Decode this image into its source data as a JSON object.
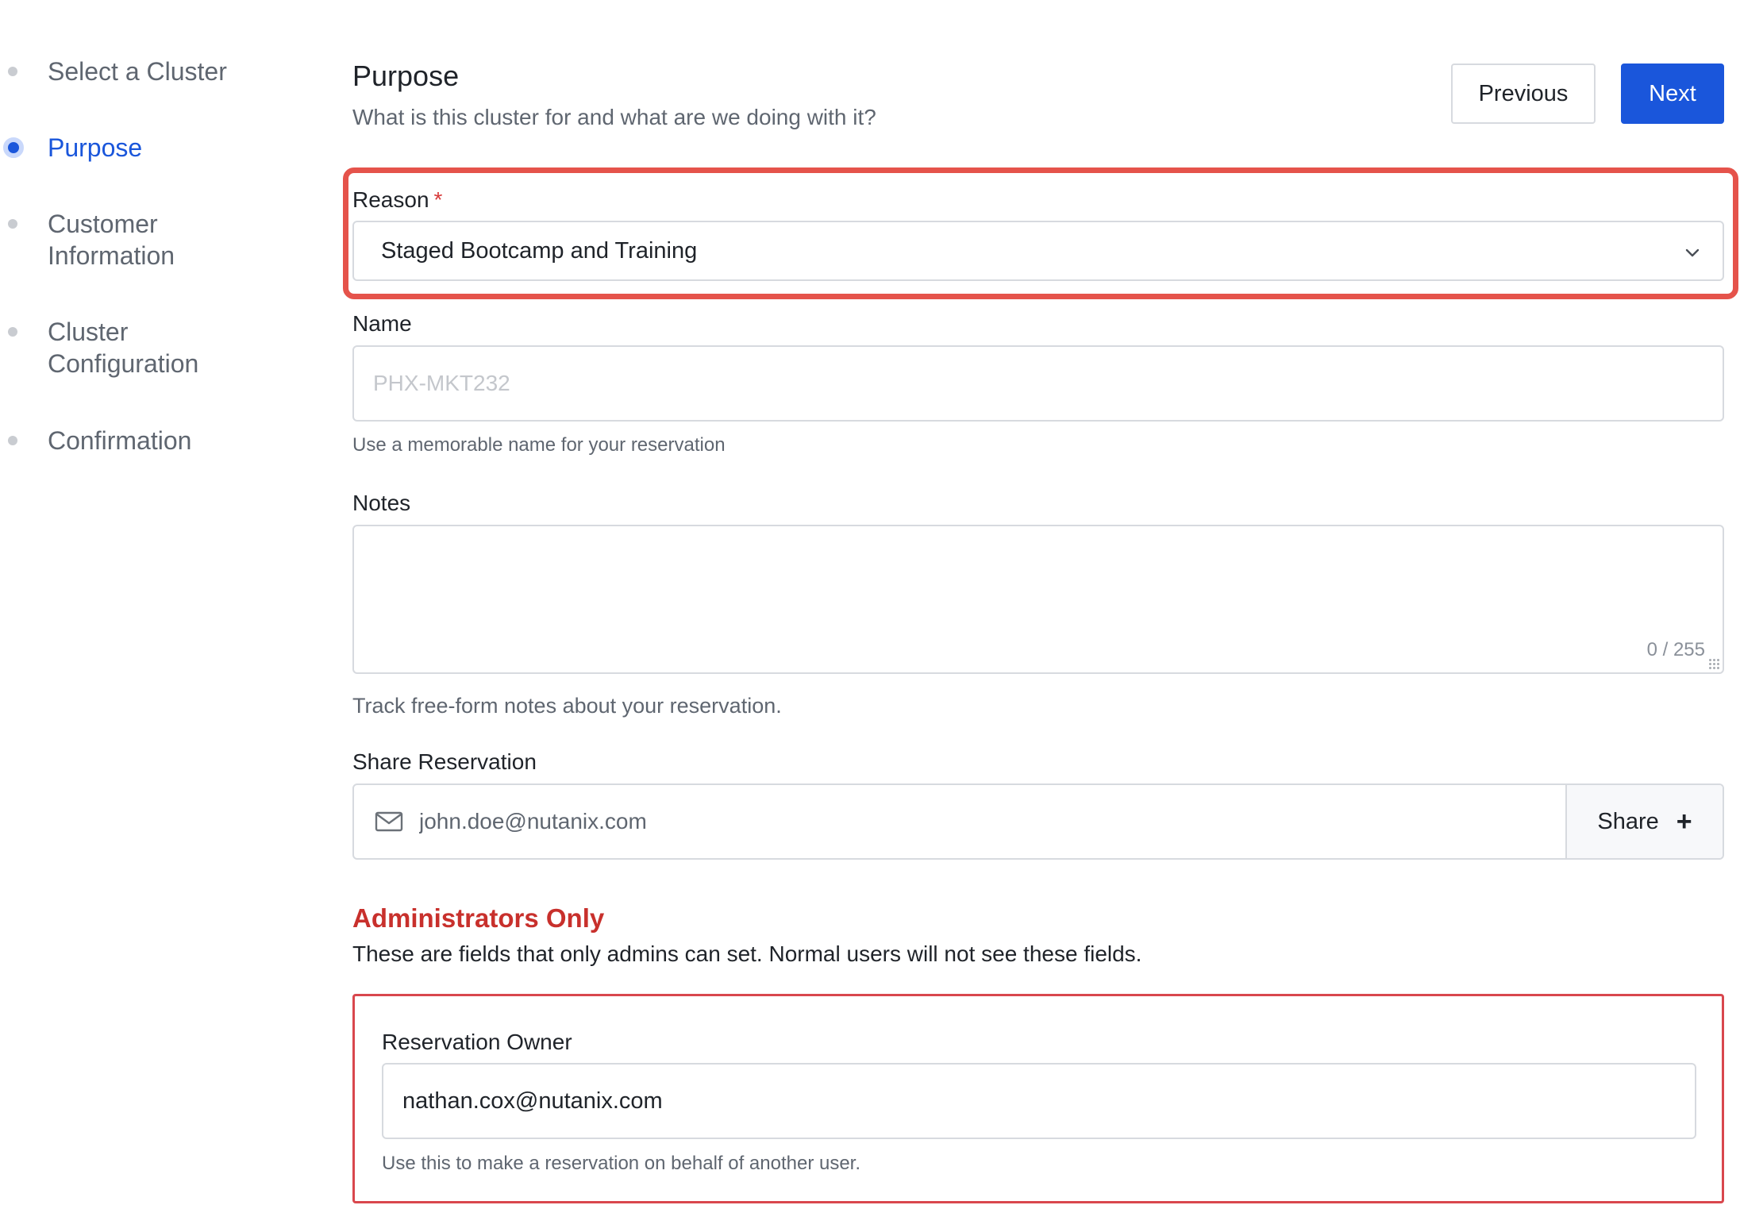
{
  "stepper": {
    "steps": [
      {
        "label": "Select a Cluster"
      },
      {
        "label": "Purpose"
      },
      {
        "label": "Customer\nInformation"
      },
      {
        "label": "Cluster\nConfiguration"
      },
      {
        "label": "Confirmation"
      }
    ],
    "active_index": 1
  },
  "header": {
    "title": "Purpose",
    "subtitle": "What is this cluster for and what are we doing with it?",
    "previous_label": "Previous",
    "next_label": "Next"
  },
  "reason": {
    "label": "Reason",
    "required_marker": "*",
    "selected_value": "Staged Bootcamp and Training"
  },
  "name": {
    "label": "Name",
    "placeholder": "PHX-MKT232",
    "value": "",
    "help": "Use a memorable name for your reservation"
  },
  "notes": {
    "label": "Notes",
    "value": "",
    "counter": "0 / 255",
    "help": "Track free-form notes about your reservation."
  },
  "share": {
    "label": "Share Reservation",
    "placeholder": "john.doe@nutanix.com",
    "button_label": "Share",
    "button_icon": "plus-icon"
  },
  "admin": {
    "title": "Administrators Only",
    "description": "These are fields that only admins can set. Normal users will not see these fields.",
    "owner_label": "Reservation Owner",
    "owner_value": "nathan.cox@nutanix.com",
    "owner_help": "Use this to make a reservation on behalf of another user."
  },
  "colors": {
    "accent": "#1a56db",
    "highlight": "#e5534b",
    "admin_red": "#c8302c",
    "muted_text": "#5f6670"
  }
}
